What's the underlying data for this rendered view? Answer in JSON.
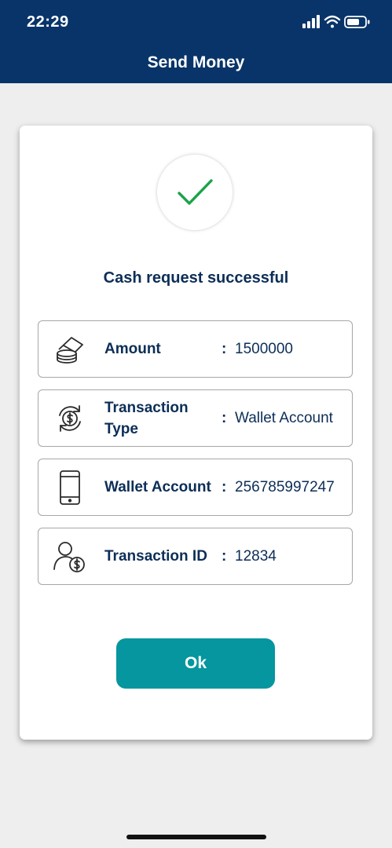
{
  "status_bar": {
    "time": "22:29",
    "icons": [
      "cellular-signal-icon",
      "wifi-icon",
      "battery-icon"
    ]
  },
  "header": {
    "title": "Send Money"
  },
  "result": {
    "icon": "checkmark-icon",
    "message": "Cash request successful"
  },
  "details": [
    {
      "icon": "cash-stack-icon",
      "label": "Amount",
      "separator": ":",
      "value": "1500000"
    },
    {
      "icon": "currency-exchange-icon",
      "label": "Transaction Type",
      "separator": ":",
      "value": "Wallet Account"
    },
    {
      "icon": "mobile-phone-icon",
      "label": "Wallet Account",
      "separator": ":",
      "value": "256785997247"
    },
    {
      "icon": "user-money-icon",
      "label": "Transaction ID",
      "separator": ":",
      "value": "12834"
    }
  ],
  "actions": {
    "ok_label": "Ok"
  },
  "colors": {
    "header_bg": "#083469",
    "page_bg": "#eeeeee",
    "primary_text": "#0c2e57",
    "button_bg": "#05969f",
    "success_green": "#1aa34a"
  }
}
